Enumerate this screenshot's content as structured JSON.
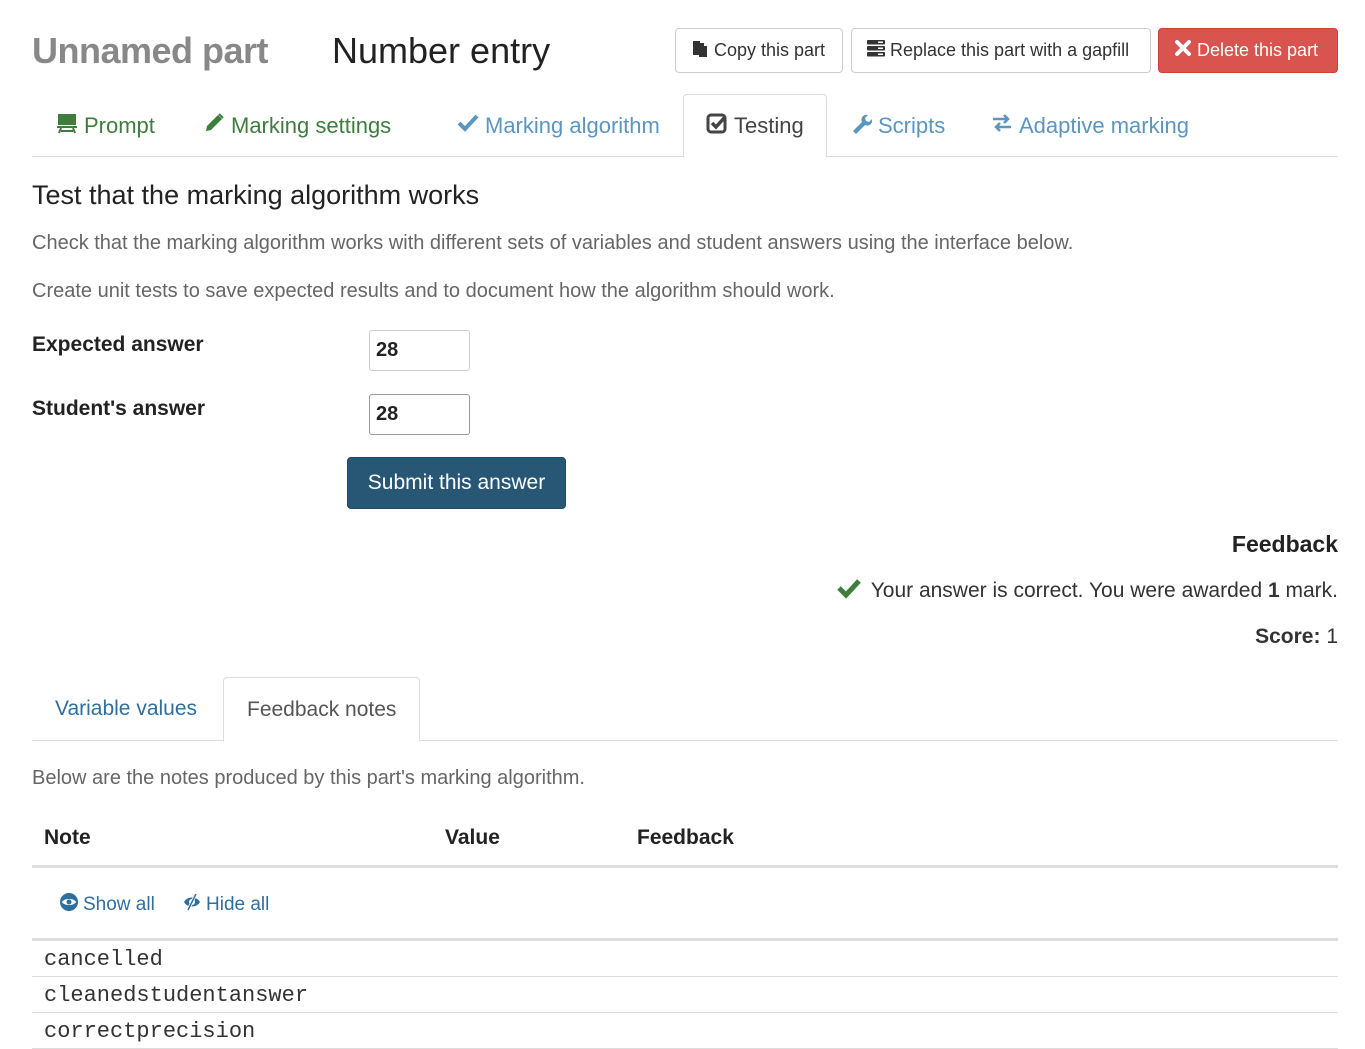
{
  "header": {
    "part_name": "Unnamed part",
    "part_type": "Number entry",
    "buttons": {
      "copy": "Copy this part",
      "gapfill": "Replace this part with a gapfill",
      "delete": "Delete this part"
    }
  },
  "tabs": [
    {
      "label": "Prompt",
      "icon": "easel-icon"
    },
    {
      "label": "Marking settings",
      "icon": "pencil-icon"
    },
    {
      "label": "Marking algorithm",
      "icon": "check-icon"
    },
    {
      "label": "Testing",
      "icon": "check-square-icon",
      "active": true
    },
    {
      "label": "Scripts",
      "icon": "wrench-icon"
    },
    {
      "label": "Adaptive marking",
      "icon": "swap-arrows-icon"
    }
  ],
  "testing": {
    "title": "Test that the marking algorithm works",
    "description1": "Check that the marking algorithm works with different sets of variables and student answers using the interface below.",
    "description2": "Create unit tests to save expected results and to document how the algorithm should work.",
    "expected_label": "Expected answer",
    "expected_value": "28",
    "student_label": "Student's answer",
    "student_value": "28",
    "submit_label": "Submit this answer"
  },
  "feedback": {
    "heading": "Feedback",
    "message_prefix": "Your answer is correct. You were awarded ",
    "marks": "1",
    "message_suffix": " mark.",
    "score_label": "Score:",
    "score_value": "1",
    "colors": {
      "success": "#3d7e3d"
    }
  },
  "subtabs": [
    {
      "label": "Variable values"
    },
    {
      "label": "Feedback notes",
      "active": true
    }
  ],
  "notes": {
    "description": "Below are the notes produced by this part's marking algorithm.",
    "columns": [
      "Note",
      "Value",
      "Feedback"
    ],
    "show_all": "Show all",
    "hide_all": "Hide all",
    "rows": [
      "cancelled",
      "cleanedstudentanswer",
      "correctprecision"
    ]
  }
}
